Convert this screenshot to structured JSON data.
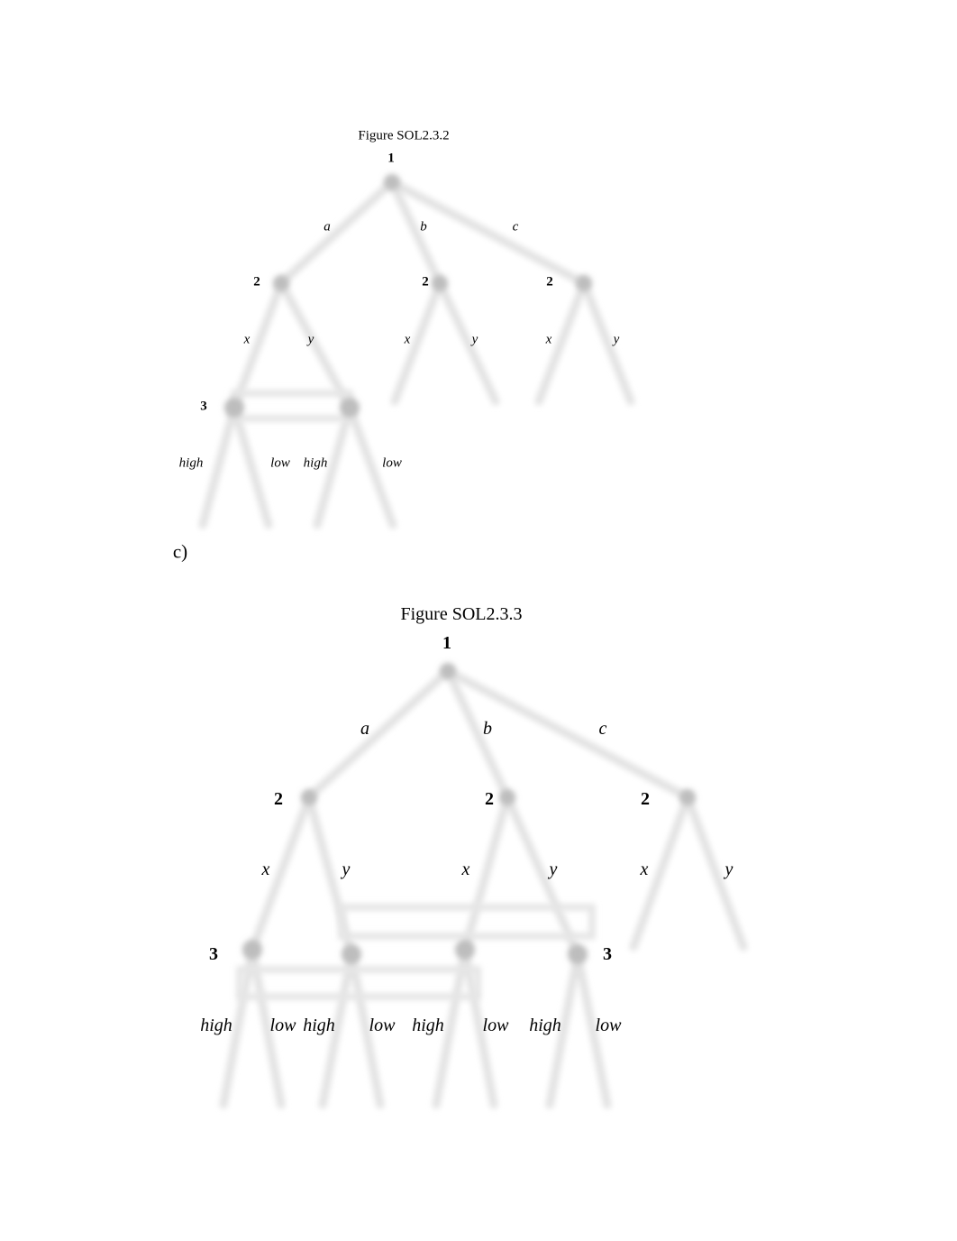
{
  "document": {
    "section_label": "c)",
    "figures": [
      {
        "caption": "Figure SOL2.3.2",
        "nodes": {
          "root": {
            "player": "1",
            "actions": [
              "a",
              "b",
              "c"
            ]
          },
          "player2_nodes": [
            {
              "player": "2",
              "actions": [
                "x",
                "y"
              ]
            },
            {
              "player": "2",
              "actions": [
                "x",
                "y"
              ]
            },
            {
              "player": "2",
              "actions": [
                "x",
                "y"
              ]
            }
          ],
          "player3_info_set": {
            "player": "3",
            "actions": [
              "high",
              "low",
              "high",
              "low"
            ]
          }
        }
      },
      {
        "caption": "Figure SOL2.3.3",
        "nodes": {
          "root": {
            "player": "1",
            "actions": [
              "a",
              "b",
              "c"
            ]
          },
          "player2_nodes": [
            {
              "player": "2",
              "actions": [
                "x",
                "y"
              ]
            },
            {
              "player": "2",
              "actions": [
                "x",
                "y"
              ]
            },
            {
              "player": "2",
              "actions": [
                "x",
                "y"
              ]
            }
          ],
          "player3_labels": [
            "3",
            "3"
          ],
          "player3_actions": [
            "high",
            "low",
            "high",
            "low",
            "high",
            "low",
            "high",
            "low"
          ]
        }
      }
    ]
  }
}
